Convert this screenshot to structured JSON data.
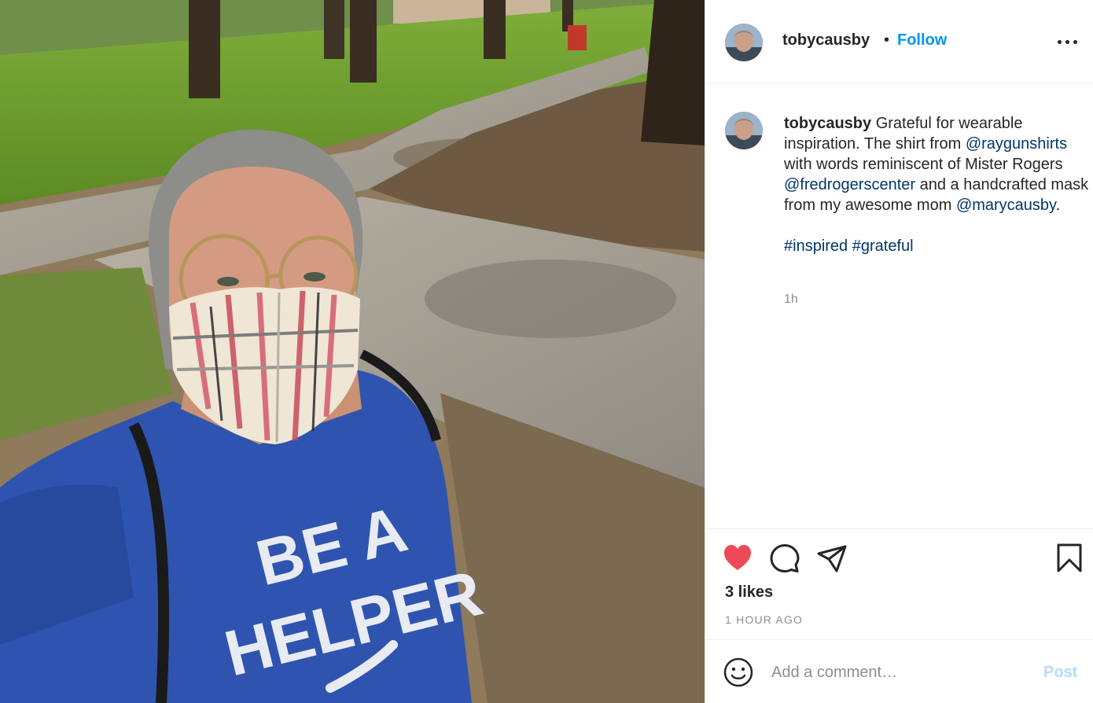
{
  "colors": {
    "accent": "#0095f6",
    "link": "#00376b",
    "like": "#ed4956",
    "muted": "#8e8e8e"
  },
  "photo": {
    "shirt_text_line1": "BE A",
    "shirt_text_line2": "HELPER"
  },
  "header": {
    "username": "tobycausby",
    "separator": "•",
    "follow_label": "Follow",
    "more_icon": "more-horizontal-icon"
  },
  "caption": {
    "username": "tobycausby",
    "text_1": " Grateful for wearable inspiration. The shirt from ",
    "mention_1": "@raygunshirts",
    "text_2": " with words reminiscent of Mister Rogers ",
    "mention_2": "@fredrogerscenter",
    "text_3": " and a handcrafted mask from my awesome mom ",
    "mention_3": "@marycausby",
    "text_4": ".",
    "hashtag_1": "#inspired",
    "hashtag_2": "#grateful",
    "time": "1h"
  },
  "actions": {
    "like_icon": "heart-filled-icon",
    "comment_icon": "comment-icon",
    "share_icon": "paper-plane-icon",
    "save_icon": "bookmark-icon",
    "likes": "3 likes",
    "posted_ago": "1 HOUR AGO"
  },
  "comment": {
    "emoji_icon": "smiley-icon",
    "placeholder": "Add a comment…",
    "post_label": "Post"
  }
}
